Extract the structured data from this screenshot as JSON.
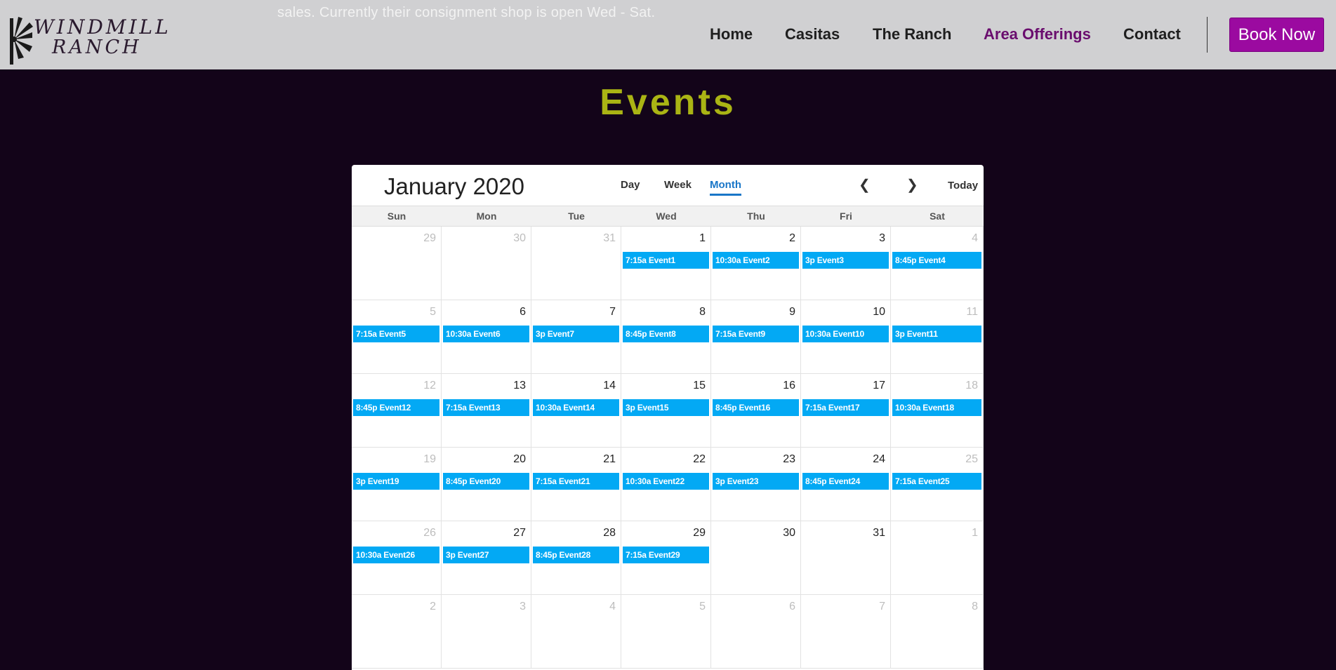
{
  "header": {
    "ghost_text": "sales. Currently their consignment shop is open Wed - Sat.",
    "logo": {
      "line1": "WINDMILL",
      "line2": "RANCH"
    },
    "nav": [
      {
        "label": "Home",
        "active": false
      },
      {
        "label": "Casitas",
        "active": false
      },
      {
        "label": "The Ranch",
        "active": false
      },
      {
        "label": "Area Offerings",
        "active": true
      },
      {
        "label": "Contact",
        "active": false
      }
    ],
    "book_label": "Book Now"
  },
  "colors": {
    "page_bg": "#130419",
    "header_bg": "#d0d0d2",
    "title": "#aab414",
    "accent": "#9b0aa0",
    "event": "#03a9f4",
    "active_view": "#1976c8"
  },
  "events_title": "Events",
  "calendar": {
    "title": "January 2020",
    "views": [
      {
        "label": "Day",
        "active": false
      },
      {
        "label": "Week",
        "active": false
      },
      {
        "label": "Month",
        "active": true
      }
    ],
    "prev_icon": "❮",
    "next_icon": "❯",
    "today_label": "Today",
    "weekdays": [
      "Sun",
      "Mon",
      "Tue",
      "Wed",
      "Thu",
      "Fri",
      "Sat"
    ],
    "weeks": [
      [
        {
          "day": "29",
          "dim": true,
          "event": null
        },
        {
          "day": "30",
          "dim": true,
          "event": null
        },
        {
          "day": "31",
          "dim": true,
          "event": null
        },
        {
          "day": "1",
          "dim": false,
          "event": "7:15a Event1"
        },
        {
          "day": "2",
          "dim": false,
          "event": "10:30a Event2"
        },
        {
          "day": "3",
          "dim": false,
          "event": "3p Event3"
        },
        {
          "day": "4",
          "dim": true,
          "event": "8:45p Event4"
        }
      ],
      [
        {
          "day": "5",
          "dim": true,
          "event": "7:15a Event5"
        },
        {
          "day": "6",
          "dim": false,
          "event": "10:30a Event6"
        },
        {
          "day": "7",
          "dim": false,
          "event": "3p Event7"
        },
        {
          "day": "8",
          "dim": false,
          "event": "8:45p Event8"
        },
        {
          "day": "9",
          "dim": false,
          "event": "7:15a Event9"
        },
        {
          "day": "10",
          "dim": false,
          "event": "10:30a Event10"
        },
        {
          "day": "11",
          "dim": true,
          "event": "3p Event11"
        }
      ],
      [
        {
          "day": "12",
          "dim": true,
          "event": "8:45p Event12"
        },
        {
          "day": "13",
          "dim": false,
          "event": "7:15a Event13"
        },
        {
          "day": "14",
          "dim": false,
          "event": "10:30a Event14"
        },
        {
          "day": "15",
          "dim": false,
          "event": "3p Event15"
        },
        {
          "day": "16",
          "dim": false,
          "event": "8:45p Event16"
        },
        {
          "day": "17",
          "dim": false,
          "event": "7:15a Event17"
        },
        {
          "day": "18",
          "dim": true,
          "event": "10:30a Event18"
        }
      ],
      [
        {
          "day": "19",
          "dim": true,
          "event": "3p Event19"
        },
        {
          "day": "20",
          "dim": false,
          "event": "8:45p Event20"
        },
        {
          "day": "21",
          "dim": false,
          "event": "7:15a Event21"
        },
        {
          "day": "22",
          "dim": false,
          "event": "10:30a Event22"
        },
        {
          "day": "23",
          "dim": false,
          "event": "3p Event23"
        },
        {
          "day": "24",
          "dim": false,
          "event": "8:45p Event24"
        },
        {
          "day": "25",
          "dim": true,
          "event": "7:15a Event25"
        }
      ],
      [
        {
          "day": "26",
          "dim": true,
          "event": "10:30a Event26"
        },
        {
          "day": "27",
          "dim": false,
          "event": "3p Event27"
        },
        {
          "day": "28",
          "dim": false,
          "event": "8:45p Event28"
        },
        {
          "day": "29",
          "dim": false,
          "event": "7:15a Event29"
        },
        {
          "day": "30",
          "dim": false,
          "event": null
        },
        {
          "day": "31",
          "dim": false,
          "event": null
        },
        {
          "day": "1",
          "dim": true,
          "event": null
        }
      ],
      [
        {
          "day": "2",
          "dim": true,
          "event": null
        },
        {
          "day": "3",
          "dim": true,
          "event": null
        },
        {
          "day": "4",
          "dim": true,
          "event": null
        },
        {
          "day": "5",
          "dim": true,
          "event": null
        },
        {
          "day": "6",
          "dim": true,
          "event": null
        },
        {
          "day": "7",
          "dim": true,
          "event": null
        },
        {
          "day": "8",
          "dim": true,
          "event": null
        }
      ]
    ]
  }
}
